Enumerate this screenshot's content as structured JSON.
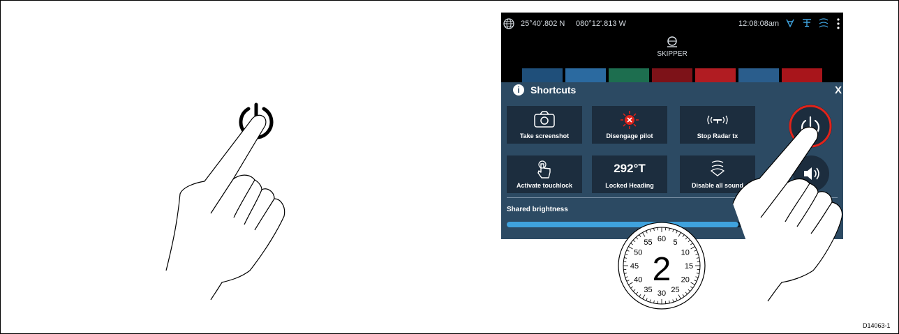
{
  "status_bar": {
    "latitude": "25°40'.802 N",
    "longitude": "080°12'.813 W",
    "time": "12:08:08am",
    "icons": [
      "globe-icon",
      "autopilot-icon",
      "radar-icon",
      "sonar-icon",
      "menu-dots-icon"
    ]
  },
  "header": {
    "mode_label": "SKIPPER",
    "mode_icon": "helm-icon"
  },
  "shortcuts": {
    "title": "Shortcuts",
    "close_label": "X",
    "buttons": [
      {
        "label": "Take screenshot",
        "icon": "camera-icon"
      },
      {
        "label": "Disengage pilot",
        "icon": "pilot-disengage-icon"
      },
      {
        "label": "Stop Radar tx",
        "icon": "radar-tx-icon"
      },
      {
        "label": "Activate touchlock",
        "icon": "touch-hand-icon"
      },
      {
        "label": "Locked Heading",
        "value": "292°T"
      },
      {
        "label": "Disable all sound",
        "icon": "sound-icon"
      }
    ],
    "power_icon": "power-icon",
    "speaker_icon": "speaker-icon",
    "brightness_label": "Shared brightness",
    "brightness_level": 0.7
  },
  "timer": {
    "value": "2",
    "dial_labels": [
      "60",
      "5",
      "10",
      "15",
      "20",
      "25",
      "30",
      "35",
      "40",
      "45",
      "50",
      "55"
    ]
  },
  "figure_id": "D14063-1",
  "colors": {
    "panel": "#2c4a63",
    "button": "#1c2d3e",
    "accent_red": "#e2231a",
    "slider": "#3fa2dd"
  }
}
